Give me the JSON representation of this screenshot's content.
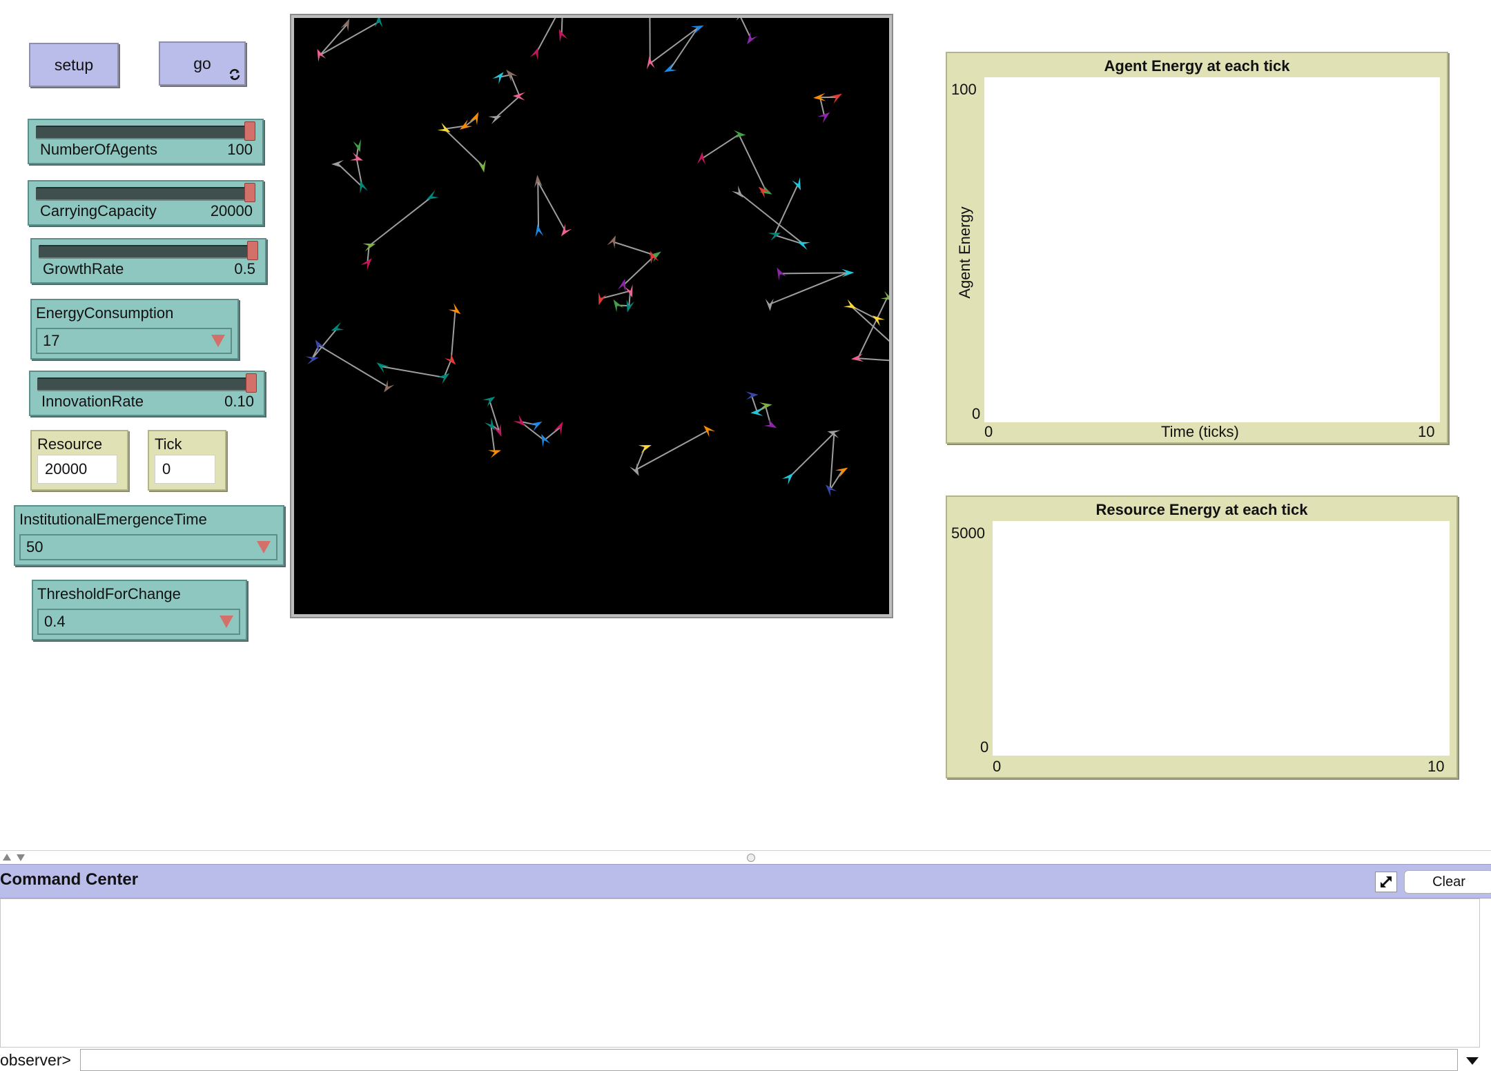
{
  "buttons": {
    "setup_label": "setup",
    "go_label": "go",
    "go_icon": "forever-icon"
  },
  "sliders": {
    "number_of_agents": {
      "label": "NumberOfAgents",
      "value": "100",
      "fraction": 1.0
    },
    "carrying_capacity": {
      "label": "CarryingCapacity",
      "value": "20000",
      "fraction": 1.0
    },
    "growth_rate": {
      "label": "GrowthRate",
      "value": "0.5",
      "fraction": 1.0
    },
    "innovation_rate": {
      "label": "InnovationRate",
      "value": "0.10",
      "fraction": 1.0
    }
  },
  "choosers": {
    "energy_consumption": {
      "label": "EnergyConsumption",
      "value": "17"
    },
    "institutional_emergence_time": {
      "label": "InstitutionalEmergenceTime",
      "value": "50"
    },
    "threshold_for_change": {
      "label": "ThresholdForChange",
      "value": "0.4"
    }
  },
  "monitors": {
    "resource": {
      "label": "Resource",
      "value": "20000"
    },
    "tick": {
      "label": "Tick",
      "value": "0"
    }
  },
  "plots": {
    "agent_energy": {
      "title": "Agent Energy at each tick",
      "ylabel": "Agent Energy",
      "xlabel": "Time (ticks)",
      "ymax": "100",
      "ymin": "0",
      "xmin": "0",
      "xmax": "10"
    },
    "resource_energy": {
      "title": "Resource Energy at each tick",
      "ymax": "5000",
      "ymin": "0",
      "xmin": "0",
      "xmax": "10"
    }
  },
  "command_center": {
    "title": "Command Center",
    "clear_label": "Clear",
    "prompt": "observer>",
    "input_value": ""
  },
  "colors": {
    "button_bg": "#babde9",
    "widget_bg": "#8ec6c0",
    "monitor_bg": "#e0e1b5",
    "thumb": "#d4706a",
    "world_bg": "#000000"
  }
}
